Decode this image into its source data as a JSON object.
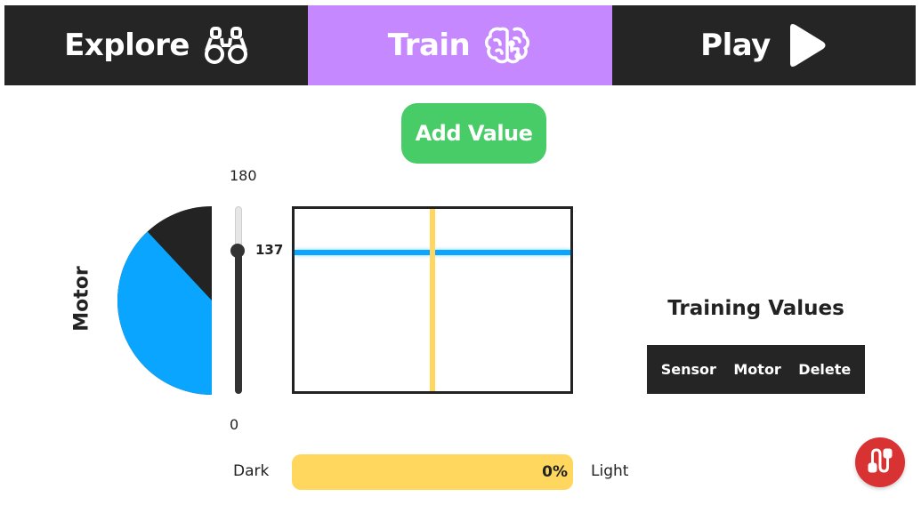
{
  "nav": {
    "tabs": [
      {
        "label": "Explore",
        "icon": "binoculars-icon",
        "active": false
      },
      {
        "label": "Train",
        "icon": "brain-icon",
        "active": true
      },
      {
        "label": "Play",
        "icon": "play-icon",
        "active": false
      }
    ]
  },
  "add_value": {
    "label": "Add Value"
  },
  "motor": {
    "label": "Motor",
    "min": 0,
    "max": 180,
    "min_label": "0",
    "max_label": "180",
    "value": 137,
    "value_label": "137"
  },
  "light": {
    "dark_label": "Dark",
    "light_label": "Light",
    "percent": 0,
    "percent_label": "0%"
  },
  "training": {
    "title": "Training Values",
    "columns": [
      "Sensor",
      "Motor",
      "Delete"
    ]
  },
  "colors": {
    "nav_bg": "#252525",
    "active_tab": "#c588ff",
    "add_button": "#47cc67",
    "motor_blue": "#0aa5ff",
    "sensor_yellow": "#ffd75e",
    "fab_red": "#d83232"
  },
  "fab": {
    "icon": "plug-cable-icon"
  }
}
